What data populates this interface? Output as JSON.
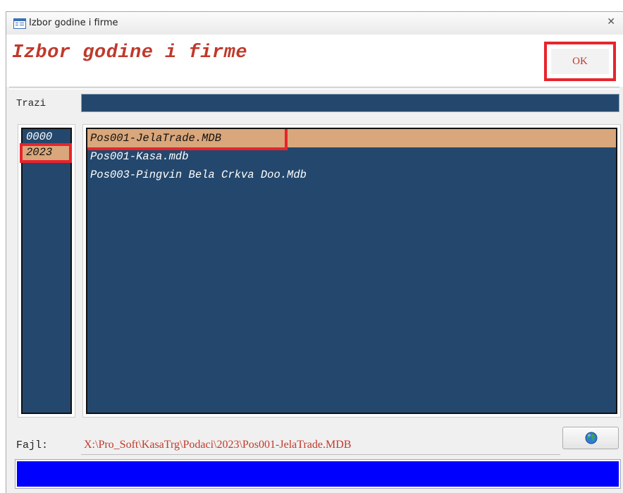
{
  "window": {
    "title": "Izbor godine i firme",
    "close_glyph": "✕",
    "icon": "form-icon"
  },
  "header": {
    "title": "Izbor godine i firme",
    "ok_label": "OK"
  },
  "search": {
    "label": "Trazi",
    "value": ""
  },
  "years": {
    "items": [
      "0000",
      "2023"
    ],
    "selected": "2023"
  },
  "files": {
    "items": [
      "Pos001-JelaTrade.MDB",
      "Pos001-Kasa.mdb",
      "Pos003-Pingvin Bela Crkva Doo.Mdb"
    ],
    "selected": "Pos001-JelaTrade.MDB"
  },
  "path": {
    "label": "Fajl:",
    "value": "X:\\Pro_Soft\\KasaTrg\\Podaci\\2023\\Pos001-JelaTrade.MDB",
    "browse_icon": "globe-icon"
  },
  "colors": {
    "list_bg": "#24486d",
    "selected_bg": "#d9a77b",
    "title_red": "#c0392b",
    "highlight_red": "#e8242c",
    "status_blue": "#0000ff"
  }
}
